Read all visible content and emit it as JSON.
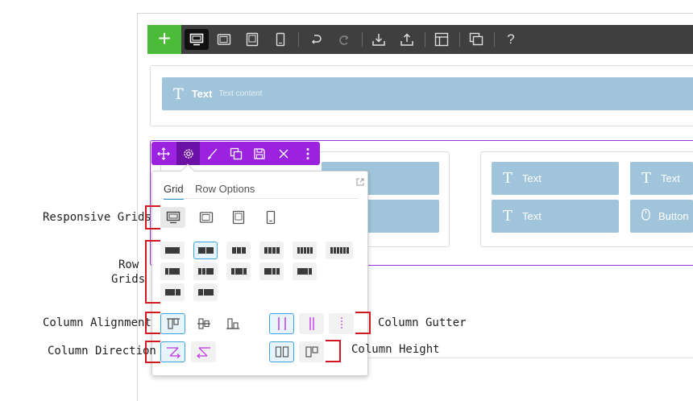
{
  "toolbar": {
    "add": "+",
    "help": "?"
  },
  "row1": {
    "text_label": "Text",
    "text_sub": "Text content"
  },
  "row2": {
    "cells": [
      "Text",
      "Text",
      "Text",
      "Button"
    ]
  },
  "panel": {
    "tabs": [
      "Grid",
      "Row Options"
    ]
  },
  "annotations": {
    "responsive_grids": "Responsive Grids",
    "row_grids_1": "Row",
    "row_grids_2": "Grids",
    "column_alignment": "Column Alignment",
    "column_direction": "Column Direction",
    "column_gutter": "Column Gutter",
    "column_height": "Column Height"
  },
  "colors": {
    "topbar": "#3f3f3f",
    "add_green": "#4cbb3a",
    "accent_purple": "#9b22df",
    "content_blue": "#a0c4d9",
    "selected_blue": "#3da3dc",
    "annotation_red": "#d3161f"
  }
}
